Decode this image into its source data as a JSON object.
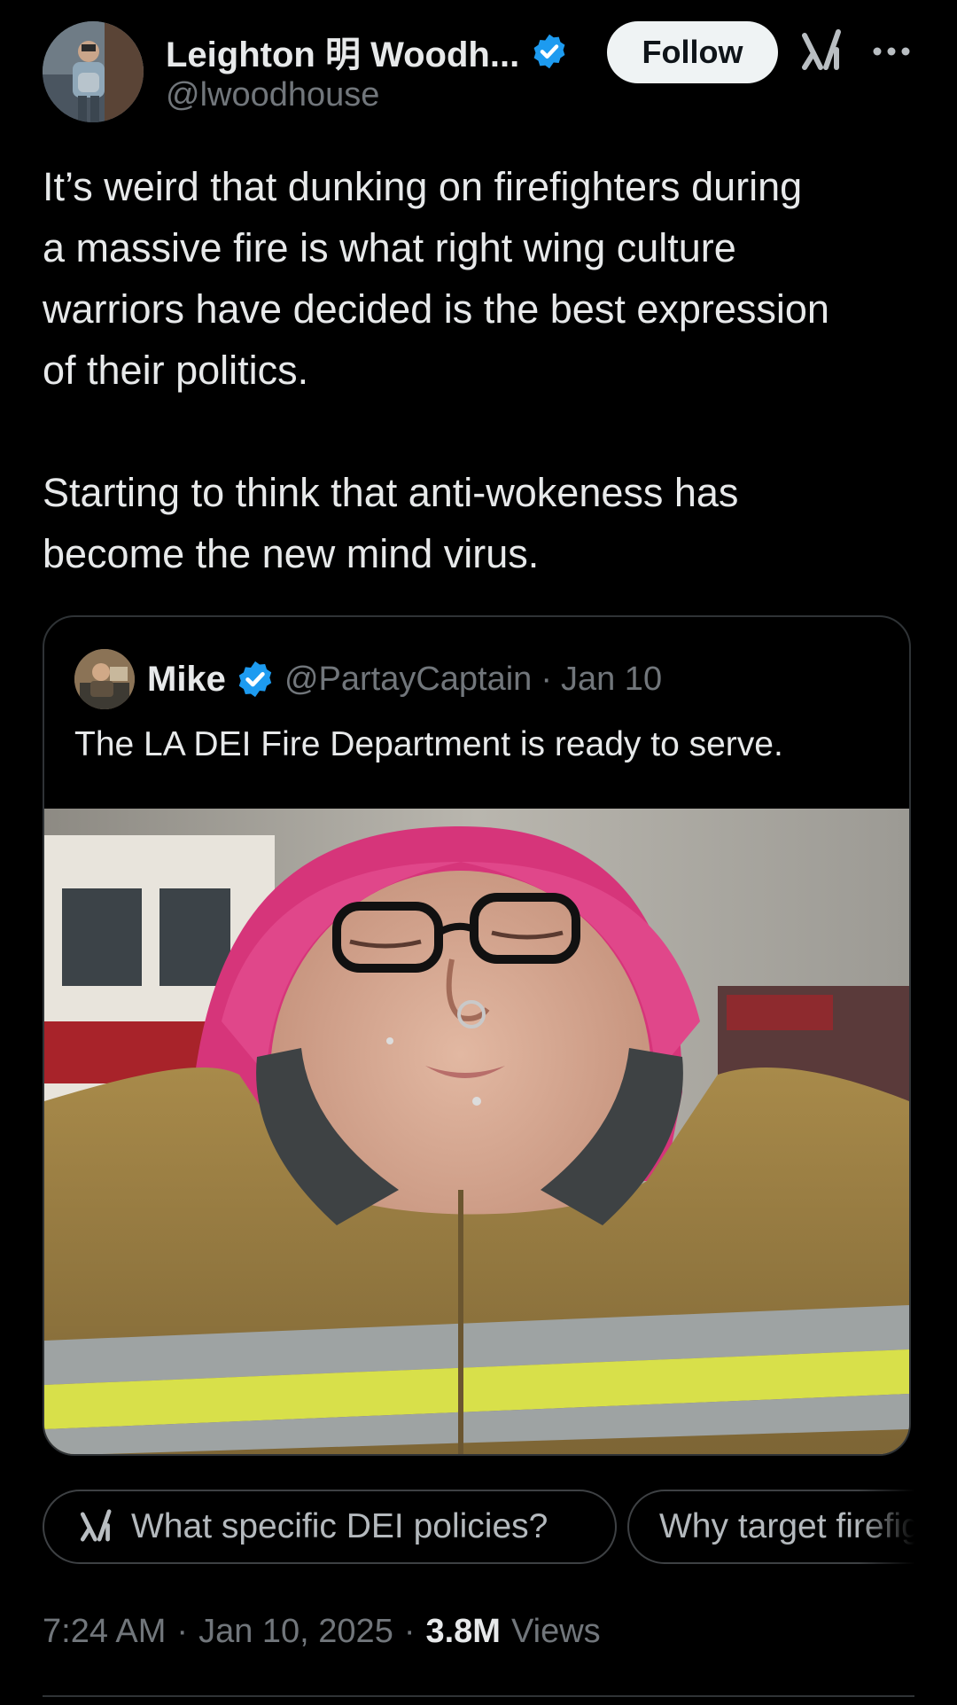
{
  "author": {
    "display_name": "Leighton 明 Woodh...",
    "handle": "@lwoodhouse",
    "verified": true,
    "follow_label": "Follow"
  },
  "icons": {
    "grok": "grok-icon",
    "more": "more-icon",
    "verified": "verified-badge-icon"
  },
  "tweet": {
    "text": "It’s weird that dunking on firefighters during\na massive fire is what right wing culture\nwarriors have decided is the best expression\nof their politics.\n\nStarting to think that anti-wokeness has\nbecome the new mind virus."
  },
  "quoted": {
    "display_name": "Mike",
    "handle": "@PartayCaptain",
    "separator": "·",
    "date": "Jan 10",
    "verified": true,
    "text": "The LA DEI Fire Department is ready to serve."
  },
  "grok_prompts": [
    {
      "label": "What specific DEI policies?"
    },
    {
      "label": "Why target firefighters?"
    }
  ],
  "meta": {
    "time": "7:24 AM",
    "sep1": "·",
    "date": "Jan 10, 2025",
    "sep2": "·",
    "views_count": "3.8M",
    "views_label": "Views"
  },
  "colors": {
    "background": "#000000",
    "text": "#e7e9ea",
    "muted": "#71767b",
    "verified_blue": "#1d9bf0",
    "border": "#2f3336"
  }
}
